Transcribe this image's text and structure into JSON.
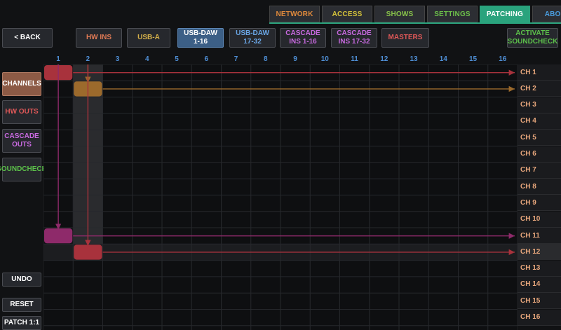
{
  "top_tabs": [
    {
      "label": "NETWORK",
      "color": "#e08a3c",
      "active": false
    },
    {
      "label": "ACCESS",
      "color": "#d4c23a",
      "active": false
    },
    {
      "label": "SHOWS",
      "color": "#88c24a",
      "active": false
    },
    {
      "label": "SETTINGS",
      "color": "#6cc04a",
      "active": false
    },
    {
      "label": "PATCHING",
      "color": "#ffffff",
      "active": true
    },
    {
      "label": "ABOUT",
      "color": "#4a9ee0",
      "active": false
    }
  ],
  "back_label": "< BACK",
  "source_tabs": [
    {
      "line1": "HW INS",
      "line2": "",
      "color": "#e07a55",
      "selected": false
    },
    {
      "line1": "USB-A",
      "line2": "",
      "color": "#d4b04a",
      "selected": false
    },
    {
      "line1": "USB-DAW",
      "line2": "1-16",
      "color": "#ffffff",
      "selected": true
    },
    {
      "line1": "USB-DAW",
      "line2": "17-32",
      "color": "#6aa6e6",
      "selected": false
    },
    {
      "line1": "CASCADE",
      "line2": "INS 1-16",
      "color": "#c86ae0",
      "selected": false
    },
    {
      "line1": "CASCADE",
      "line2": "INS 17-32",
      "color": "#c86ae0",
      "selected": false
    },
    {
      "line1": "MASTERS",
      "line2": "",
      "color": "#e05858",
      "selected": false
    }
  ],
  "activate": {
    "line1": "ACTIVATE",
    "line2": "SOUNDCHECK",
    "color": "#5cc04a"
  },
  "left_nav": [
    {
      "line1": "CHANNELS",
      "line2": "",
      "color": "#ffffff",
      "active": true
    },
    {
      "line1": "HW OUTS",
      "line2": "",
      "color": "#e05858",
      "active": false
    },
    {
      "line1": "CASCADE",
      "line2": "OUTS",
      "color": "#c86ae0",
      "active": false
    },
    {
      "line1": "SOUNDCHECK",
      "line2": "",
      "color": "#5cc04a",
      "active": false
    }
  ],
  "bottom_buttons": {
    "undo": "UNDO",
    "reset": "RESET",
    "patch": "PATCH 1:1"
  },
  "columns": [
    "1",
    "2",
    "3",
    "4",
    "5",
    "6",
    "7",
    "8",
    "9",
    "10",
    "11",
    "12",
    "13",
    "14",
    "15",
    "16"
  ],
  "channels": [
    "CH 1",
    "CH 2",
    "CH 3",
    "CH 4",
    "CH 5",
    "CH 6",
    "CH 7",
    "CH 8",
    "CH 9",
    "CH 10",
    "CH 11",
    "CH 12",
    "CH 13",
    "CH 14",
    "CH 15",
    "CH 16"
  ],
  "highlighted_channel_index": 11,
  "highlighted_column_index": 1,
  "routes": [
    {
      "col": 1,
      "row": 1,
      "color": "#a8323c"
    },
    {
      "col": 2,
      "row": 2,
      "color": "#9c6a2c"
    },
    {
      "col": 1,
      "row": 11,
      "color": "#8e2a6a"
    },
    {
      "col": 2,
      "row": 12,
      "color": "#a8323c"
    }
  ]
}
